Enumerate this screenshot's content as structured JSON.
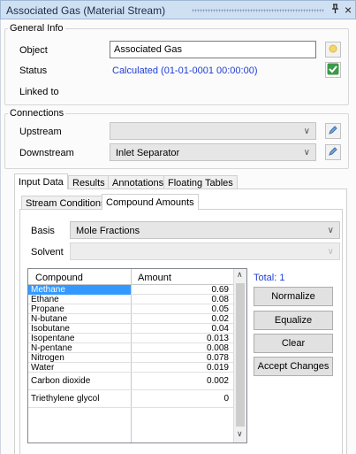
{
  "window": {
    "title": "Associated Gas (Material Stream)",
    "pin_icon": "pin-icon",
    "close_label": "×"
  },
  "general": {
    "title": "General Info",
    "object_label": "Object",
    "object_value": "Associated Gas",
    "status_label": "Status",
    "status_value": "Calculated (01-01-0001 00:00:00)",
    "linked_label": "Linked to"
  },
  "connections": {
    "title": "Connections",
    "upstream_label": "Upstream",
    "upstream_value": "",
    "downstream_label": "Downstream",
    "downstream_value": "Inlet Separator"
  },
  "tabs": {
    "input": "Input Data",
    "results": "Results",
    "annotations": "Annotations",
    "floating": "Floating Tables"
  },
  "subtabs": {
    "conditions": "Stream Conditions",
    "compound": "Compound Amounts"
  },
  "basis": {
    "label": "Basis",
    "value": "Mole Fractions"
  },
  "solvent": {
    "label": "Solvent",
    "value": ""
  },
  "grid": {
    "col_compound": "Compound",
    "col_amount": "Amount",
    "rows": [
      {
        "name": "Methane",
        "amount": "0.69",
        "selected": true
      },
      {
        "name": "Ethane",
        "amount": "0.08"
      },
      {
        "name": "Propane",
        "amount": "0.05"
      },
      {
        "name": "N-butane",
        "amount": "0.02"
      },
      {
        "name": "Isobutane",
        "amount": "0.04"
      },
      {
        "name": "Isopentane",
        "amount": "0.013"
      },
      {
        "name": "N-pentane",
        "amount": "0.008"
      },
      {
        "name": "Nitrogen",
        "amount": "0.078"
      },
      {
        "name": "Water",
        "amount": "0.019"
      },
      {
        "name": "Carbon dioxide",
        "amount": "0.002"
      },
      {
        "name": "Triethylene glycol",
        "amount": "0"
      }
    ]
  },
  "total": "Total: 1",
  "buttons": {
    "normalize": "Normalize",
    "equalize": "Equalize",
    "clear": "Clear",
    "accept": "Accept Changes"
  },
  "colors": {
    "status_blue": "#1e3dd6",
    "selection": "#3399ff",
    "title_bg": "#cfe0f3"
  }
}
